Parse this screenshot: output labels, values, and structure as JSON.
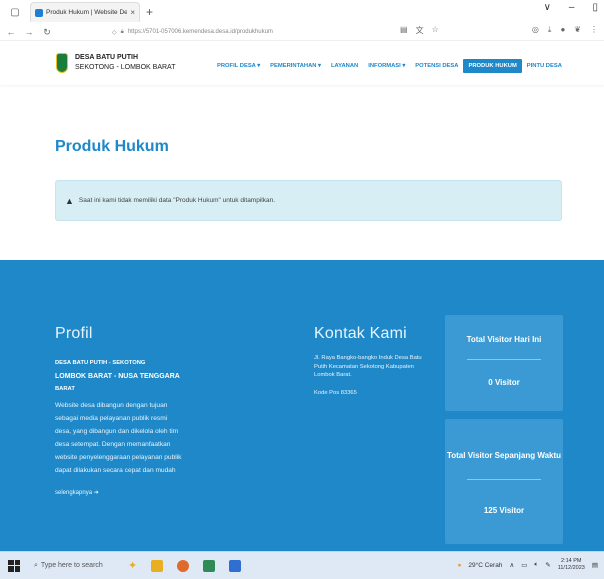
{
  "browser": {
    "tab_title": "Produk Hukum | Website Desa",
    "tab_close": "×",
    "new_tab": "+",
    "url": "https://5701-057006.kemendesa.desa.id/produkhukum",
    "minimize": "–",
    "restore": "▯",
    "dropdown": "∨"
  },
  "site": {
    "brand_line1": "DESA BATU PUTIH",
    "brand_line2": "SEKOTONG - LOMBOK BARAT",
    "menu": [
      {
        "label": "PROFIL DESA ▾"
      },
      {
        "label": "PEMERINTAHAN ▾"
      },
      {
        "label": "LAYANAN"
      },
      {
        "label": "INFORMASI ▾"
      },
      {
        "label": "POTENSI DESA"
      },
      {
        "label": "PRODUK HUKUM"
      },
      {
        "label": "PINTU DESA"
      }
    ]
  },
  "main": {
    "title": "Produk Hukum",
    "alert_text": "Saat ini kami tidak memiliki data \"Produk Hukum\" untuk ditampilkan."
  },
  "footer": {
    "profil_heading": "Profil",
    "profil_name_line1": "DESA BATU PUTIH - SEKOTONG",
    "profil_name_line2": "LOMBOK BARAT - NUSA TENGGARA",
    "profil_name_line3": "BARAT",
    "profil_desc": "Website desa dibangun dengan tujuan sebagai media pelayanan publik resmi desa, yang dibangun dan dikelola oleh tim desa setempat. Dengan memanfaatkan website penyelenggaraan pelayanan publik dapat dilakukan secara cepat dan mudah",
    "more_link": "selengkapnya ➜",
    "kontak_heading": "Kontak Kami",
    "kontak_address": "Jl. Raya Bangko-bangko Induk Desa Batu Putih Kecamatan Sekotong Kabupaten Lombok Barat.",
    "kontak_postal": "Kode Pos 83365",
    "stat1_title": "Total Visitor Hari Ini",
    "stat1_value": "0 Visitor",
    "stat2_title": "Total Visitor Sepanjang Waktu",
    "stat2_value": "125 Visitor"
  },
  "taskbar": {
    "search_placeholder": "Type here to search",
    "weather": "29°C Cerah",
    "time": "2:14 PM",
    "date": "11/12/2023"
  },
  "colors": {
    "accent": "#1e88c9",
    "alert_bg": "#d8eef5",
    "stat_bg": "#3b9ad3"
  }
}
